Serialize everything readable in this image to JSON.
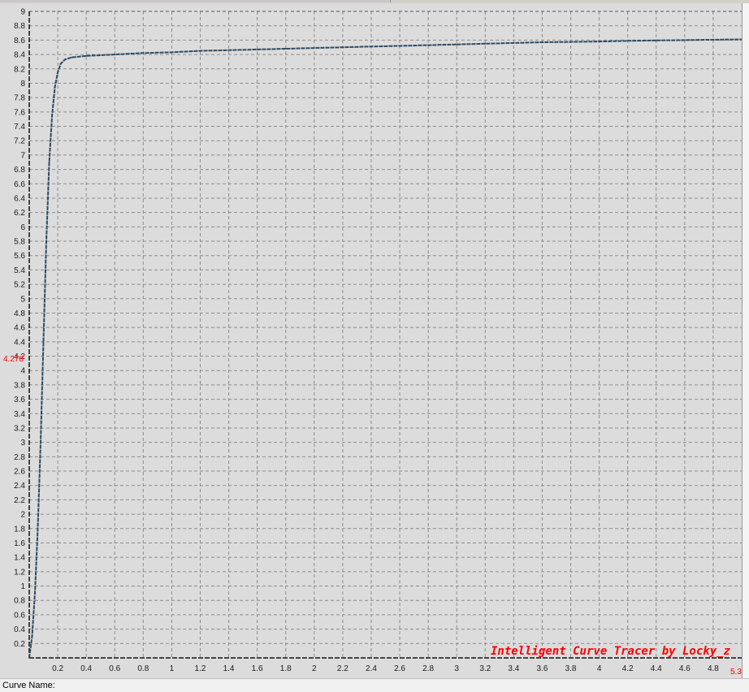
{
  "chart_data": {
    "type": "line",
    "xlabel": "",
    "ylabel": "",
    "xlim": [
      0,
      5
    ],
    "ylim": [
      0,
      9
    ],
    "xticks": [
      0.2,
      0.4,
      0.6,
      0.8,
      1,
      1.2,
      1.4,
      1.6,
      1.8,
      2,
      2.2,
      2.4,
      2.6,
      2.8,
      3,
      3.2,
      3.4,
      3.6,
      3.8,
      4,
      4.2,
      4.4,
      4.6,
      4.8
    ],
    "yticks": [
      0.2,
      0.4,
      0.6,
      0.8,
      1,
      1.2,
      1.4,
      1.6,
      1.8,
      2,
      2.2,
      2.4,
      2.6,
      2.8,
      3,
      3.2,
      3.4,
      3.6,
      3.8,
      4,
      4.2,
      4.4,
      4.6,
      4.8,
      5,
      5.2,
      5.4,
      5.6,
      5.8,
      6,
      6.2,
      6.4,
      6.6,
      6.8,
      7,
      7.2,
      7.4,
      7.6,
      7.8,
      8,
      8.2,
      8.4,
      8.6,
      8.8,
      9
    ],
    "grid": true,
    "series": [
      {
        "color": "#2e4a62",
        "points": [
          [
            0,
            0
          ],
          [
            0.02,
            0.3
          ],
          [
            0.04,
            0.9
          ],
          [
            0.06,
            1.8
          ],
          [
            0.08,
            3.0
          ],
          [
            0.1,
            4.4
          ],
          [
            0.12,
            5.8
          ],
          [
            0.14,
            6.9
          ],
          [
            0.16,
            7.55
          ],
          [
            0.18,
            7.95
          ],
          [
            0.2,
            8.15
          ],
          [
            0.22,
            8.27
          ],
          [
            0.25,
            8.33
          ],
          [
            0.3,
            8.36
          ],
          [
            0.4,
            8.38
          ],
          [
            0.6,
            8.4
          ],
          [
            0.8,
            8.42
          ],
          [
            1.0,
            8.43
          ],
          [
            1.2,
            8.45
          ],
          [
            1.4,
            8.46
          ],
          [
            1.6,
            8.47
          ],
          [
            1.8,
            8.48
          ],
          [
            2.0,
            8.49
          ],
          [
            2.2,
            8.5
          ],
          [
            2.4,
            8.51
          ],
          [
            2.6,
            8.52
          ],
          [
            2.8,
            8.53
          ],
          [
            3.0,
            8.54
          ],
          [
            3.2,
            8.55
          ],
          [
            3.4,
            8.56
          ],
          [
            3.6,
            8.57
          ],
          [
            3.8,
            8.575
          ],
          [
            4.0,
            8.58
          ],
          [
            4.2,
            8.59
          ],
          [
            4.4,
            8.595
          ],
          [
            4.6,
            8.6
          ],
          [
            4.8,
            8.605
          ],
          [
            5.0,
            8.61
          ]
        ]
      }
    ],
    "cursor": {
      "y_label": "4.278",
      "x_label": "5.3"
    },
    "watermark": "Intelligent Curve Tracer by Locky_z",
    "colors": {
      "background": "#dcdcdc",
      "grid": "#8c8c8c",
      "curve": "#2e4a62",
      "cursor_text": "#ff0000",
      "watermark": "#ff0000"
    }
  },
  "statusbar": {
    "curve_name_label": "Curve Name:",
    "curve_name_value": ""
  }
}
